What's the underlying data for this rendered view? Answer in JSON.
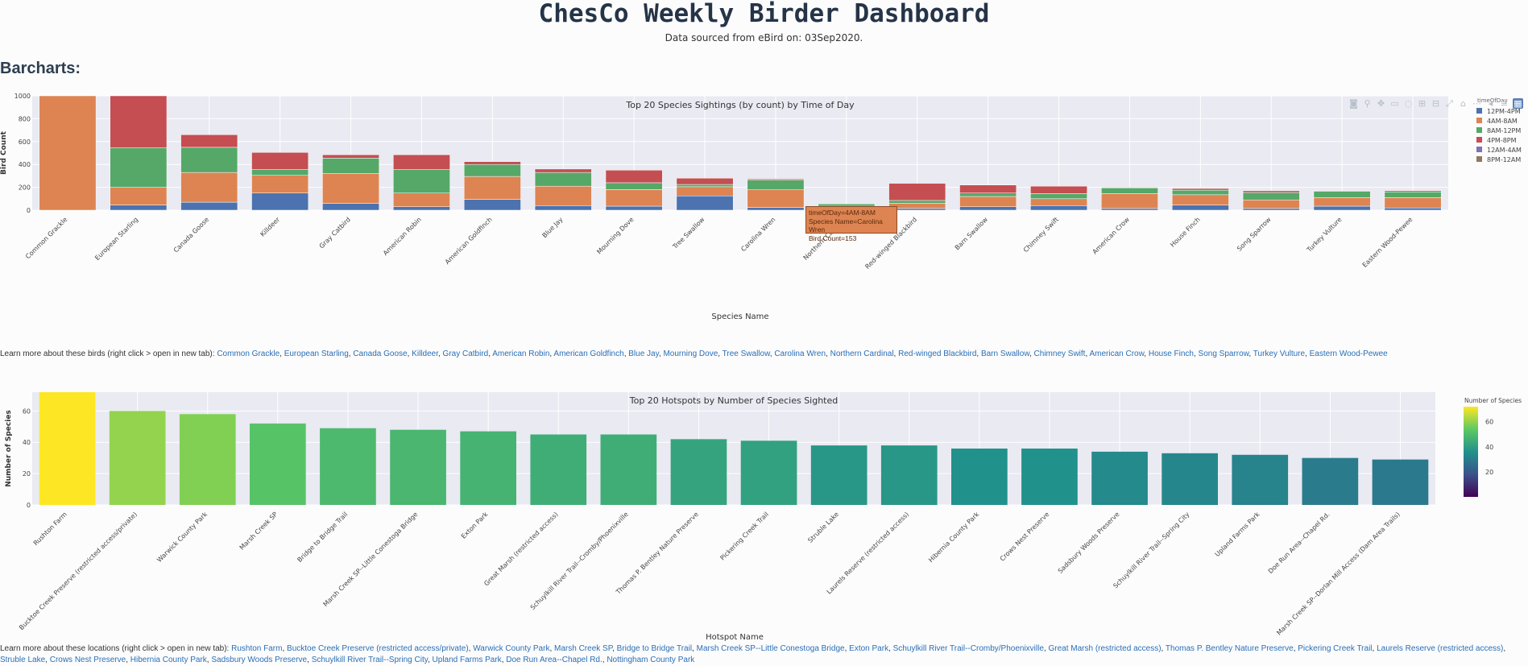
{
  "header": {
    "title": "ChesCo Weekly Birder Dashboard",
    "subtitle": "Data sourced from eBird on: 03Sep2020.",
    "section_heading": "Barcharts:"
  },
  "colors": {
    "12PM-4PM": "#4c72b0",
    "4AM-8AM": "#dd8452",
    "8AM-12PM": "#55a868",
    "4PM-8PM": "#c44e52",
    "12AM-4AM": "#8172b3",
    "8PM-12AM": "#937860",
    "plot_bg": "#e9eaf2"
  },
  "modebar": {
    "icons": [
      "camera-icon",
      "zoom-icon",
      "pan-icon",
      "box-select-icon",
      "lasso-icon",
      "zoom-in-icon",
      "zoom-out-icon",
      "autoscale-icon",
      "reset-axes-icon",
      "spike-lines-icon",
      "hover-closest-icon",
      "hover-compare-icon",
      "plotly-logo-icon"
    ]
  },
  "tooltip": {
    "line1": "timeOfDay=4AM-8AM",
    "line2": "Species Name=Carolina Wren",
    "line3": "Bird Count=153"
  },
  "chart_data": [
    {
      "type": "bar",
      "stacked": true,
      "title": "Top 20 Species Sightings (by count) by Time of Day",
      "xlabel": "Species Name",
      "ylabel": "Bird Count",
      "ylim": [
        0,
        1000
      ],
      "yticks": [
        0,
        200,
        400,
        600,
        800,
        1000
      ],
      "legend_title": "timeOfDay",
      "legend_position": "right",
      "categories": [
        "Common Grackle",
        "European Starling",
        "Canada Goose",
        "Killdeer",
        "Gray Catbird",
        "American Robin",
        "American Goldfinch",
        "Blue Jay",
        "Mourning Dove",
        "Tree Swallow",
        "Carolina Wren",
        "Northern Cardinal",
        "Red-winged Blackbird",
        "Barn Swallow",
        "Chimney Swift",
        "American Crow",
        "House Finch",
        "Song Sparrow",
        "Turkey Vulture",
        "Eastern Wood-Pewee"
      ],
      "series": [
        {
          "name": "12PM-4PM",
          "values": [
            0,
            45,
            70,
            150,
            60,
            30,
            95,
            40,
            35,
            125,
            25,
            35,
            15,
            30,
            40,
            15,
            45,
            15,
            35,
            20
          ]
        },
        {
          "name": "4AM-8AM",
          "values": [
            1000,
            155,
            260,
            155,
            260,
            120,
            200,
            170,
            145,
            80,
            153,
            0,
            45,
            90,
            60,
            130,
            90,
            75,
            75,
            90
          ]
        },
        {
          "name": "8AM-12PM",
          "values": [
            0,
            345,
            220,
            50,
            135,
            205,
            105,
            120,
            60,
            20,
            85,
            20,
            25,
            30,
            45,
            50,
            40,
            65,
            55,
            50
          ]
        },
        {
          "name": "4PM-8PM",
          "values": [
            0,
            455,
            110,
            150,
            30,
            130,
            25,
            30,
            110,
            55,
            10,
            0,
            150,
            70,
            65,
            5,
            15,
            15,
            5,
            10
          ]
        },
        {
          "name": "12AM-4AM",
          "values": [
            0,
            0,
            0,
            0,
            0,
            0,
            0,
            0,
            0,
            0,
            0,
            0,
            0,
            0,
            0,
            0,
            0,
            0,
            0,
            0
          ]
        },
        {
          "name": "8PM-12AM",
          "values": [
            0,
            0,
            0,
            0,
            0,
            0,
            0,
            0,
            0,
            0,
            0,
            0,
            0,
            0,
            0,
            0,
            5,
            0,
            0,
            0
          ]
        }
      ]
    },
    {
      "type": "bar",
      "title": "Top 20 Hotspots by Number of Species Sighted",
      "xlabel": "Hotspot Name",
      "ylabel": "Number of Species",
      "ylim": [
        0,
        72
      ],
      "yticks": [
        0,
        20,
        40,
        60
      ],
      "colorbar_title": "Number of Species",
      "colorbar_ticks": [
        20,
        40,
        60
      ],
      "colorscale": "viridis",
      "categories": [
        "Rushton Farm",
        "Bucktoe Creek Preserve (restricted access/private)",
        "Warwick County Park",
        "Marsh Creek SP",
        "Bridge to Bridge Trail",
        "Marsh Creek SP--Little Conestoga Bridge",
        "Exton Park",
        "Great Marsh (restricted access)",
        "Schuylkill River Trail--Cromby/Phoenixville",
        "Thomas P. Bentley Nature Preserve",
        "Pickering Creek Trail",
        "Struble Lake",
        "Laurels Reserve (restricted access)",
        "Hibernia County Park",
        "Crows Nest Preserve",
        "Sadsbury Woods Preserve",
        "Schuylkill River Trail--Spring City",
        "Upland Farms Park",
        "Doe Run Area--Chapel Rd.",
        "Marsh Creek SP--Dorlan Mill Access (Dam Area Trails)"
      ],
      "values": [
        72,
        60,
        58,
        52,
        49,
        48,
        47,
        45,
        45,
        42,
        41,
        38,
        38,
        36,
        36,
        34,
        33,
        32,
        30,
        29
      ]
    }
  ],
  "links": {
    "birds_prefix": "Learn more about these birds (right click > open in new tab):",
    "birds": [
      "Common Grackle",
      "European Starling",
      "Canada Goose",
      "Killdeer",
      "Gray Catbird",
      "American Robin",
      "American Goldfinch",
      "Blue Jay",
      "Mourning Dove",
      "Tree Swallow",
      "Carolina Wren",
      "Northern Cardinal",
      "Red-winged Blackbird",
      "Barn Swallow",
      "Chimney Swift",
      "American Crow",
      "House Finch",
      "Song Sparrow",
      "Turkey Vulture",
      "Eastern Wood-Pewee"
    ],
    "locations_prefix": "Learn more about these locations (right click > open in new tab):",
    "locations": [
      "Rushton Farm",
      "Bucktoe Creek Preserve (restricted access/private)",
      "Warwick County Park",
      "Marsh Creek SP",
      "Bridge to Bridge Trail",
      "Marsh Creek SP--Little Conestoga Bridge",
      "Exton Park",
      "Schuylkill River Trail--Cromby/Phoenixville",
      "Great Marsh (restricted access)",
      "Thomas P. Bentley Nature Preserve",
      "Pickering Creek Trail",
      "Laurels Reserve (restricted access)",
      "Struble Lake",
      "Crows Nest Preserve",
      "Hibernia County Park",
      "Sadsbury Woods Preserve",
      "Schuylkill River Trail--Spring City",
      "Upland Farms Park",
      "Doe Run Area--Chapel Rd.",
      "Nottingham County Park"
    ]
  }
}
